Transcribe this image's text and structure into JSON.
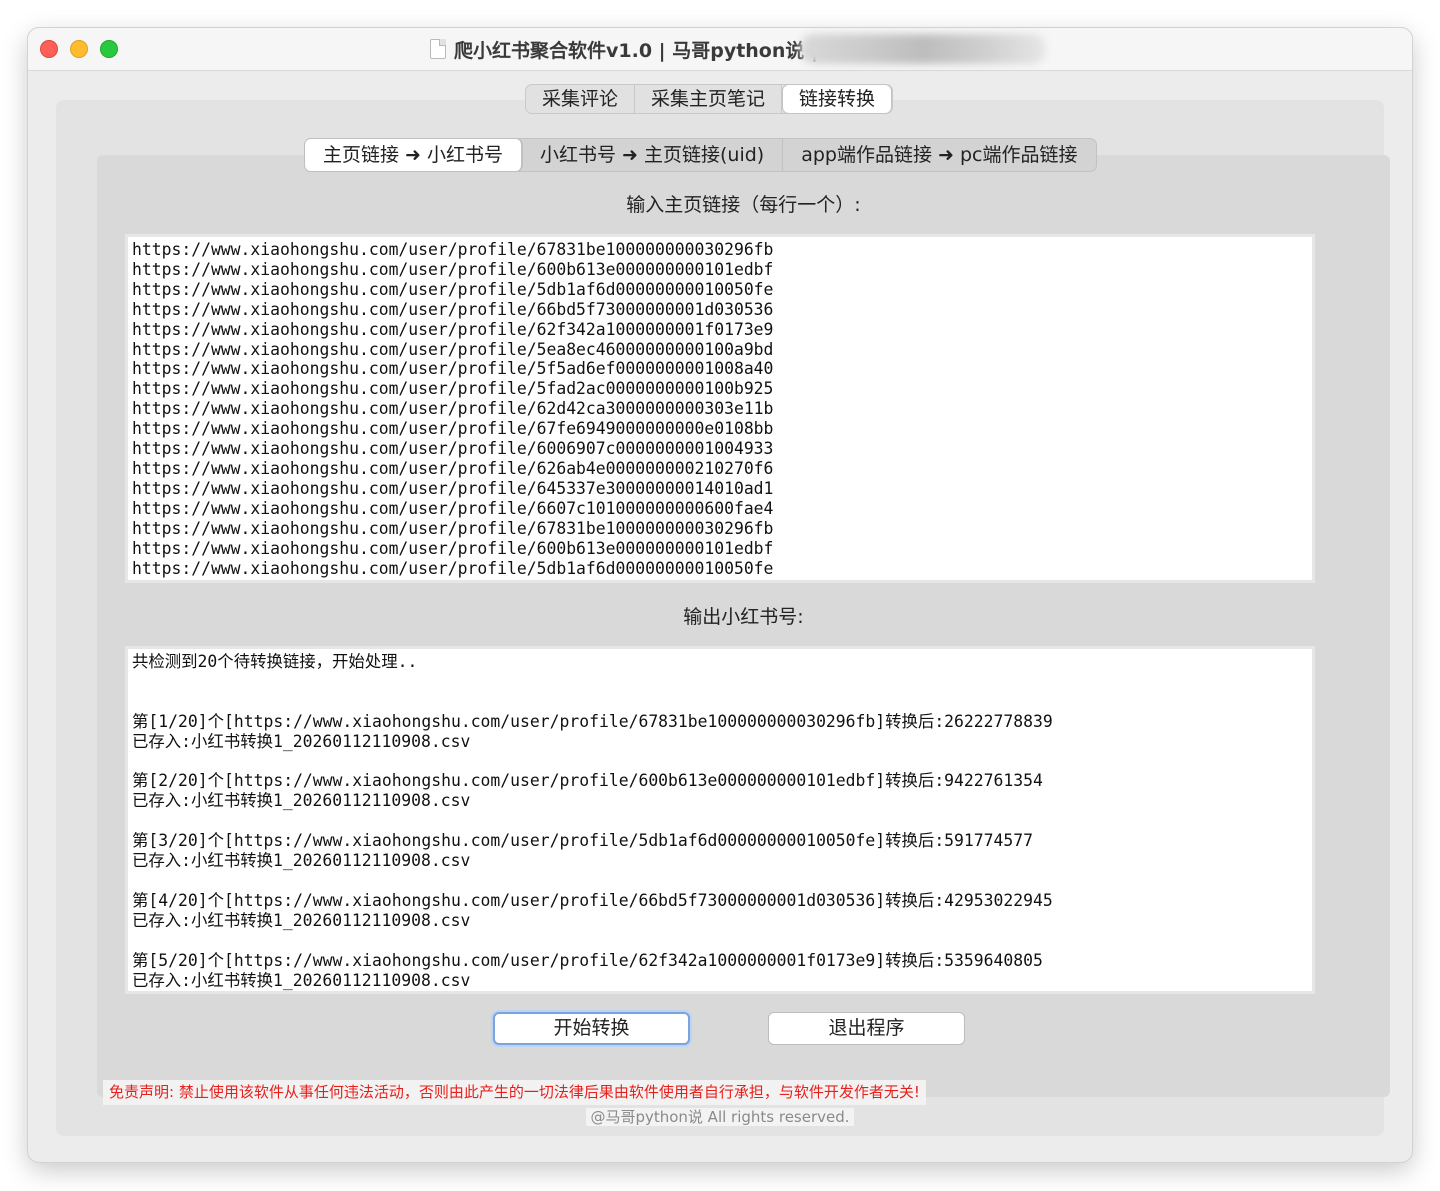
{
  "window": {
    "title": "爬小红书聚合软件v1.0 | 马哥python说 |"
  },
  "main_tabs": [
    {
      "label": "采集评论"
    },
    {
      "label": "采集主页笔记"
    },
    {
      "label": "链接转换"
    }
  ],
  "sub_tabs": [
    {
      "label": "主页链接 ➜ 小红书号"
    },
    {
      "label": "小红书号 ➜ 主页链接(uid)"
    },
    {
      "label": "app端作品链接 ➜ pc端作品链接"
    }
  ],
  "input_section": {
    "label": "输入主页链接（每行一个）:",
    "value": "https://www.xiaohongshu.com/user/profile/67831be100000000030296fb\nhttps://www.xiaohongshu.com/user/profile/600b613e000000000101edbf\nhttps://www.xiaohongshu.com/user/profile/5db1af6d00000000010050fe\nhttps://www.xiaohongshu.com/user/profile/66bd5f73000000001d030536\nhttps://www.xiaohongshu.com/user/profile/62f342a1000000001f0173e9\nhttps://www.xiaohongshu.com/user/profile/5ea8ec46000000000100a9bd\nhttps://www.xiaohongshu.com/user/profile/5f5ad6ef0000000001008a40\nhttps://www.xiaohongshu.com/user/profile/5fad2ac0000000000100b925\nhttps://www.xiaohongshu.com/user/profile/62d42ca3000000000303e11b\nhttps://www.xiaohongshu.com/user/profile/67fe6949000000000e0108bb\nhttps://www.xiaohongshu.com/user/profile/6006907c0000000001004933\nhttps://www.xiaohongshu.com/user/profile/626ab4e000000000210270f6\nhttps://www.xiaohongshu.com/user/profile/645337e30000000014010ad1\nhttps://www.xiaohongshu.com/user/profile/6607c101000000000600fae4\nhttps://www.xiaohongshu.com/user/profile/67831be100000000030296fb\nhttps://www.xiaohongshu.com/user/profile/600b613e000000000101edbf\nhttps://www.xiaohongshu.com/user/profile/5db1af6d00000000010050fe"
  },
  "output_section": {
    "label": "输出小红书号:",
    "value": "共检测到20个待转换链接，开始处理..\n\n\n第[1/20]个[https://www.xiaohongshu.com/user/profile/67831be100000000030296fb]转换后:26222778839\n已存入:小红书转换1_20260112110908.csv\n\n第[2/20]个[https://www.xiaohongshu.com/user/profile/600b613e000000000101edbf]转换后:9422761354\n已存入:小红书转换1_20260112110908.csv\n\n第[3/20]个[https://www.xiaohongshu.com/user/profile/5db1af6d00000000010050fe]转换后:591774577\n已存入:小红书转换1_20260112110908.csv\n\n第[4/20]个[https://www.xiaohongshu.com/user/profile/66bd5f73000000001d030536]转换后:42953022945\n已存入:小红书转换1_20260112110908.csv\n\n第[5/20]个[https://www.xiaohongshu.com/user/profile/62f342a1000000001f0173e9]转换后:5359640805\n已存入:小红书转换1_20260112110908.csv"
  },
  "buttons": {
    "start": "开始转换",
    "exit": "退出程序"
  },
  "footer": {
    "disclaimer": "免责声明: 禁止使用该软件从事任何违法活动，否则由此产生的一切法律后果由软件使用者自行承担，与软件开发作者无关!",
    "copyright": "@马哥python说 All rights reserved."
  },
  "colors": {
    "disclaimer_text": "#e8201c",
    "primary_button_focus": "#7aa3e0"
  }
}
